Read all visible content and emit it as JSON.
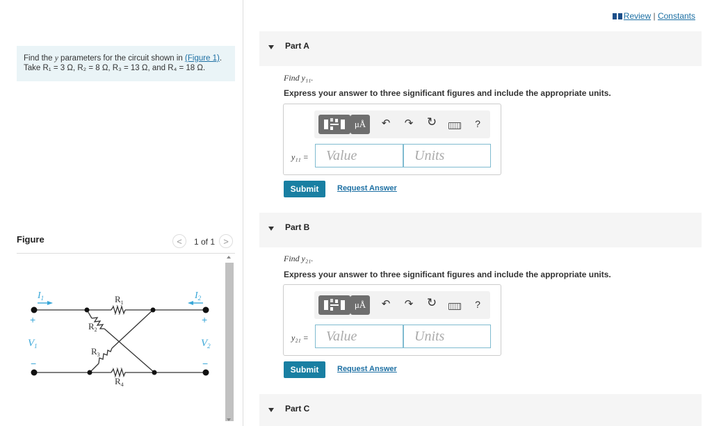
{
  "header": {
    "review": "Review",
    "separator": "|",
    "constants": "Constants"
  },
  "problem": {
    "pre": "Find the ",
    "yvar": "y",
    "mid": " parameters for the circuit shown in ",
    "link": "(Figure 1)",
    "post": ".",
    "line2": "Take R₁ = 3 Ω, R₂ = 8 Ω, R₃ = 13 Ω, and R₄ = 18 Ω."
  },
  "figure": {
    "title": "Figure",
    "count": "1 of 1",
    "prev": "<",
    "next": ">",
    "labels": {
      "i1": "I",
      "i1sub": "1",
      "i2": "I",
      "i2sub": "2",
      "v1": "V",
      "v1sub": "1",
      "v2": "V",
      "v2sub": "2",
      "r1": "R",
      "r1sub": "1",
      "r2": "R",
      "r2sub": "2",
      "r3": "R",
      "r3sub": "3",
      "r4": "R",
      "r4sub": "4",
      "plus": "+",
      "minus": "−"
    }
  },
  "toolbar": {
    "mu": "μÅ",
    "undo": "↶",
    "redo": "↷",
    "reset": "↻",
    "help": "?"
  },
  "parts": [
    {
      "title": "Part A",
      "find": "Find y₁₁.",
      "instruction": "Express your answer to three significant figures and include the appropriate units.",
      "eq_label": "y₁₁ =",
      "value_placeholder": "Value",
      "units_placeholder": "Units",
      "submit": "Submit",
      "request": "Request Answer"
    },
    {
      "title": "Part B",
      "find": "Find y₂₁.",
      "instruction": "Express your answer to three significant figures and include the appropriate units.",
      "eq_label": "y₂₁ =",
      "value_placeholder": "Value",
      "units_placeholder": "Units",
      "submit": "Submit",
      "request": "Request Answer"
    },
    {
      "title": "Part C"
    }
  ],
  "colors": {
    "accent": "#197fa2",
    "link": "#1c6fa3",
    "figure_label": "#3aa7d8",
    "band": "#f5f5f5"
  }
}
